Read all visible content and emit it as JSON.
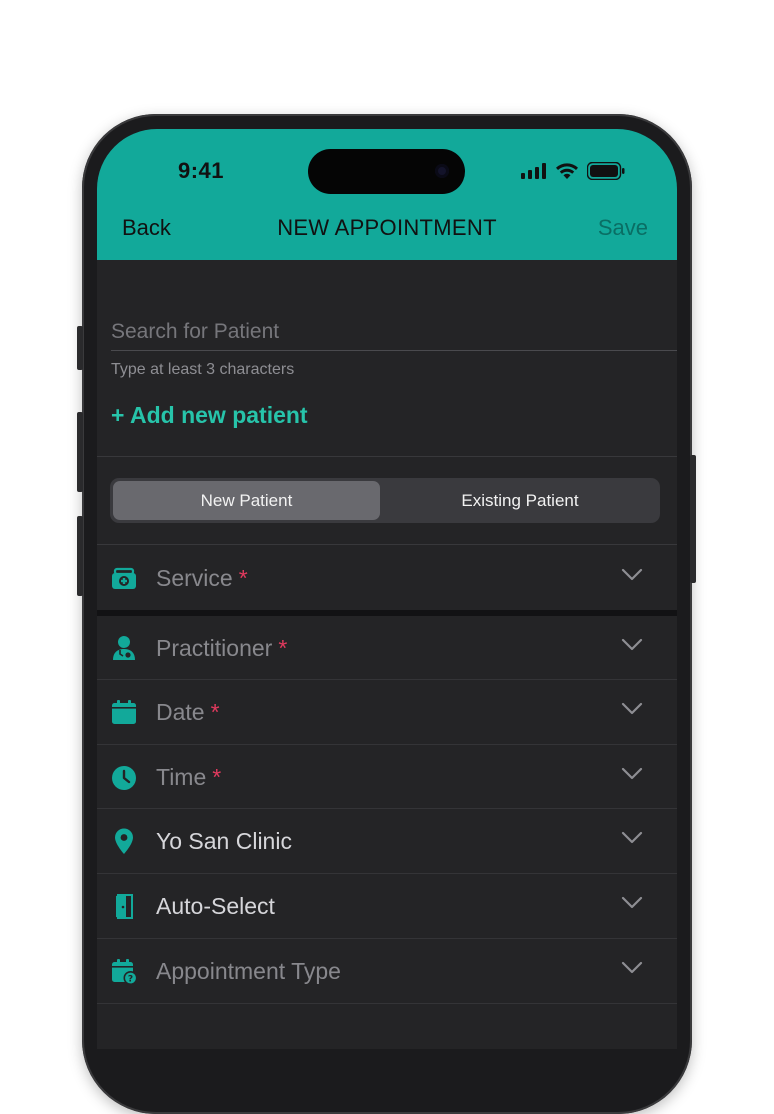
{
  "status_bar": {
    "time": "9:41"
  },
  "nav": {
    "back_label": "Back",
    "title": "NEW APPOINTMENT",
    "save_label": "Save"
  },
  "search": {
    "placeholder": "Search for Patient",
    "value": "",
    "hint": "Type at least 3 characters"
  },
  "add_patient_label": "+ Add new patient",
  "segment": {
    "options": [
      "New Patient",
      "Existing Patient"
    ],
    "selected": "New Patient"
  },
  "fields": [
    {
      "label": "Service",
      "required_mark": "*",
      "icon": "medical-bag-icon"
    },
    {
      "label": "Practitioner",
      "required_mark": "*",
      "icon": "doctor-icon"
    },
    {
      "label": "Date",
      "required_mark": "*",
      "icon": "calendar-icon"
    },
    {
      "label": "Time",
      "required_mark": "*",
      "icon": "clock-icon"
    },
    {
      "label": "Yo San Clinic",
      "required_mark": "",
      "icon": "location-pin-icon"
    },
    {
      "label": "Auto-Select",
      "required_mark": "",
      "icon": "door-icon"
    },
    {
      "label": "Appointment Type",
      "required_mark": "",
      "icon": "calendar-question-icon"
    }
  ],
  "colors": {
    "accent": "#12a99a",
    "link": "#27c4aa",
    "required": "#e23a5e",
    "background": "#242426"
  }
}
